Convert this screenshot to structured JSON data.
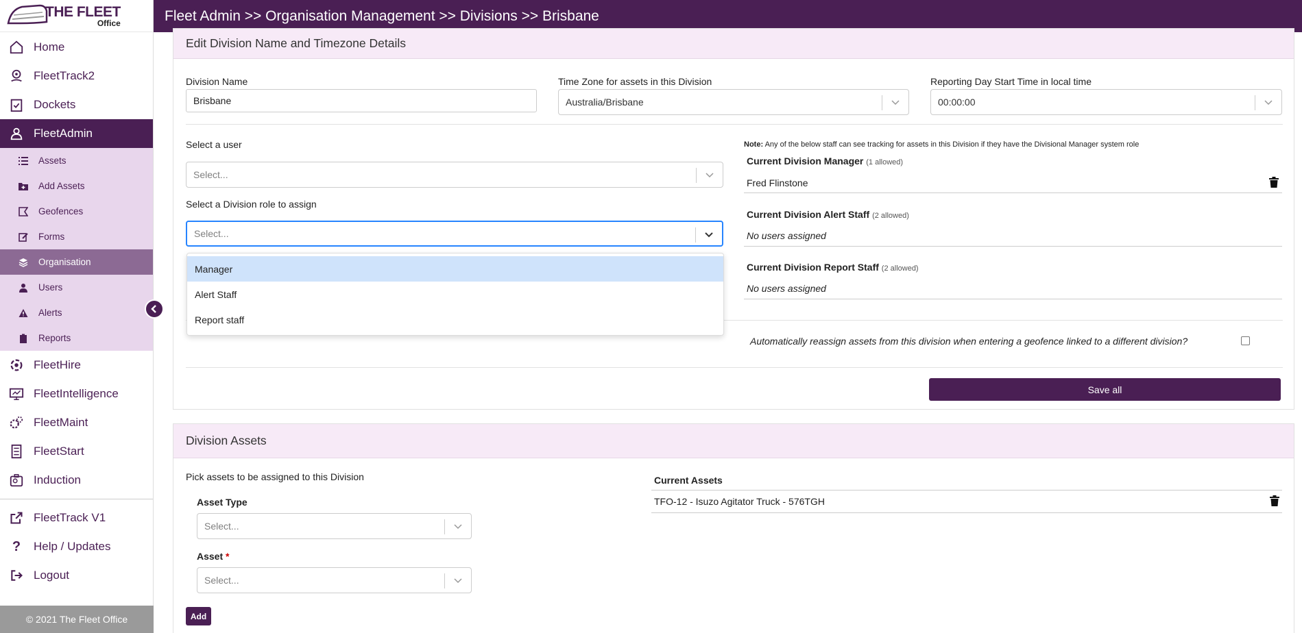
{
  "brand": {
    "line1": "THE FLEET",
    "line2": "Office"
  },
  "breadcrumb": "Fleet Admin >> Organisation Management >> Divisions >> Brisbane",
  "sidebar": {
    "items": [
      {
        "label": "Home",
        "icon": "home-icon"
      },
      {
        "label": "FleetTrack2",
        "icon": "map-pin-icon"
      },
      {
        "label": "Dockets",
        "icon": "clipboard-check-icon"
      },
      {
        "label": "FleetAdmin",
        "icon": "user-admin-icon",
        "active": true
      }
    ],
    "sub_items": [
      {
        "label": "Assets",
        "icon": "list-icon"
      },
      {
        "label": "Add Assets",
        "icon": "folder-plus-icon"
      },
      {
        "label": "Geofences",
        "icon": "geofence-icon"
      },
      {
        "label": "Forms",
        "icon": "edit-icon"
      },
      {
        "label": "Organisation",
        "icon": "layers-icon",
        "active": true
      },
      {
        "label": "Users",
        "icon": "user-icon"
      },
      {
        "label": "Alerts",
        "icon": "warning-icon"
      },
      {
        "label": "Reports",
        "icon": "clipboard-icon"
      }
    ],
    "items2": [
      {
        "label": "FleetHire",
        "icon": "fleethire-icon"
      },
      {
        "label": "FleetIntelligence",
        "icon": "dashboard-icon"
      },
      {
        "label": "FleetMaint",
        "icon": "gears-icon"
      },
      {
        "label": "FleetStart",
        "icon": "checklist-icon"
      },
      {
        "label": "Induction",
        "icon": "induction-icon"
      }
    ],
    "items3": [
      {
        "label": "FleetTrack V1",
        "icon": "external-link-icon"
      },
      {
        "label": "Help / Updates",
        "icon": "question-icon"
      },
      {
        "label": "Logout",
        "icon": "logout-icon"
      }
    ],
    "footer": "© 2021 The Fleet Office"
  },
  "edit_card": {
    "title": "Edit Division Name and Timezone Details",
    "division_name_label": "Division Name",
    "division_name_value": "Brisbane",
    "timezone_label": "Time Zone for assets in this Division",
    "timezone_value": "Australia/Brisbane",
    "reporting_label": "Reporting Day Start Time in local time",
    "reporting_value": "00:00:00",
    "select_user_label": "Select a user",
    "select_user_placeholder": "Select...",
    "select_role_label": "Select a Division role to assign",
    "select_role_placeholder": "Select...",
    "role_options": [
      "Manager",
      "Alert Staff",
      "Report staff"
    ],
    "note_bold": "Note:",
    "note_text": "Any of the below staff can see tracking for assets in this Division if they have the Divisional Manager system role",
    "manager_title": "Current Division Manager",
    "manager_allowed": "(1 allowed)",
    "manager_value": "Fred Flinstone",
    "alert_title": "Current Division Alert Staff",
    "alert_allowed": "(2 allowed)",
    "alert_value": "No users assigned",
    "report_title": "Current Division Report Staff",
    "report_allowed": "(2 allowed)",
    "report_value": "No users assigned",
    "reassign_text": "Automatically reassign assets from this division when entering a geofence linked to a different division?",
    "save_label": "Save all"
  },
  "assets_card": {
    "title": "Division Assets",
    "pick_label": "Pick assets to be assigned to this Division",
    "asset_type_label": "Asset Type",
    "asset_type_placeholder": "Select...",
    "asset_label": "Asset",
    "asset_required": "*",
    "asset_placeholder": "Select...",
    "add_label": "Add",
    "current_title": "Current Assets",
    "current_items": [
      "TFO-12 - Isuzo Agitator Truck - 576TGH"
    ]
  },
  "colors": {
    "brand": "#4a1f54",
    "submenu": "#e8d6ec",
    "focus": "#2684ff",
    "highlight": "#cfe3fb"
  }
}
